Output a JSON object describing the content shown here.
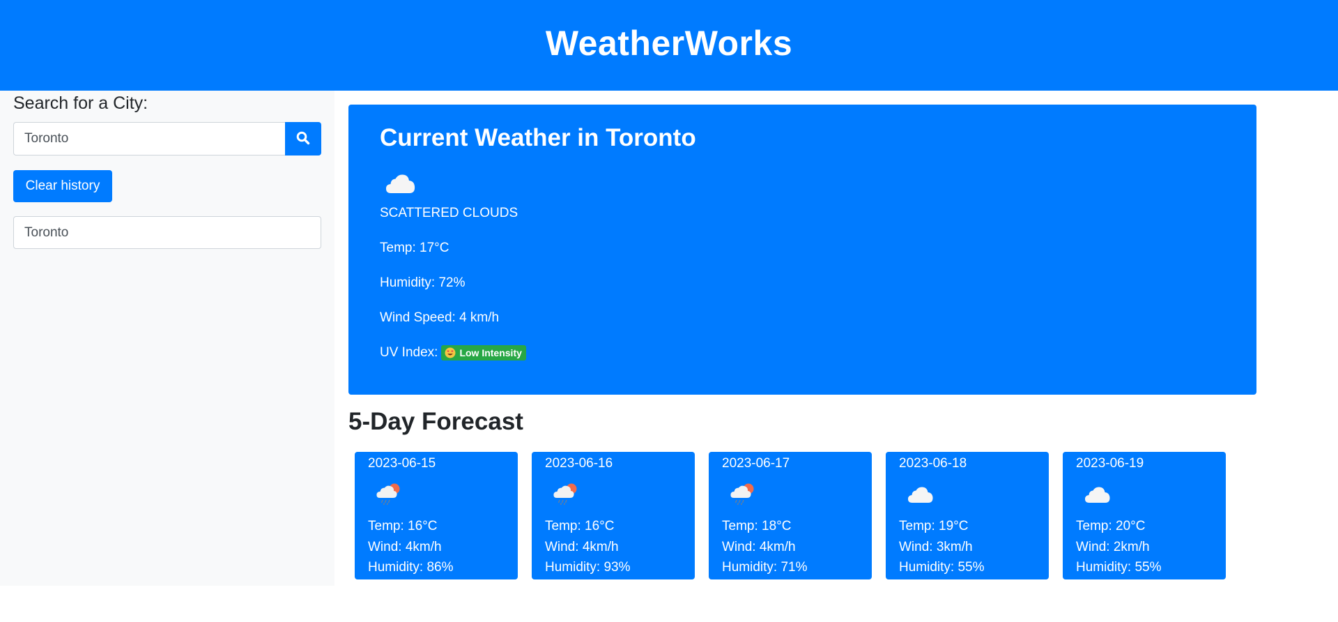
{
  "app": {
    "title": "WeatherWorks",
    "accent_color": "#007bff",
    "uv_low_color": "#28a745"
  },
  "sidebar": {
    "search_label": "Search for a City:",
    "search_value": "Toronto",
    "search_icon": "search-icon",
    "clear_label": "Clear history",
    "history": [
      "Toronto"
    ]
  },
  "current": {
    "title": "Current Weather in Toronto",
    "icon": "cloud-icon",
    "description": "SCATTERED CLOUDS",
    "temp": "Temp: 17°C",
    "humidity": "Humidity: 72%",
    "wind": "Wind Speed: 4 km/h",
    "uv_label": "UV Index:",
    "uv_badge": "Low Intensity",
    "uv_icon": "smiling-face-with-heart-eyes-icon"
  },
  "forecast": {
    "heading": "5-Day Forecast",
    "days": [
      {
        "date": "2023-06-15",
        "icon": "sun-rain-cloud-icon",
        "temp": "Temp: 16°C",
        "wind": "Wind: 4km/h",
        "humidity": "Humidity: 86%"
      },
      {
        "date": "2023-06-16",
        "icon": "sun-rain-cloud-icon",
        "temp": "Temp: 16°C",
        "wind": "Wind: 4km/h",
        "humidity": "Humidity: 93%"
      },
      {
        "date": "2023-06-17",
        "icon": "sun-rain-cloud-icon",
        "temp": "Temp: 18°C",
        "wind": "Wind: 4km/h",
        "humidity": "Humidity: 71%"
      },
      {
        "date": "2023-06-18",
        "icon": "cloud-icon",
        "temp": "Temp: 19°C",
        "wind": "Wind: 3km/h",
        "humidity": "Humidity: 55%"
      },
      {
        "date": "2023-06-19",
        "icon": "cloud-icon",
        "temp": "Temp: 20°C",
        "wind": "Wind: 2km/h",
        "humidity": "Humidity: 55%"
      }
    ]
  }
}
